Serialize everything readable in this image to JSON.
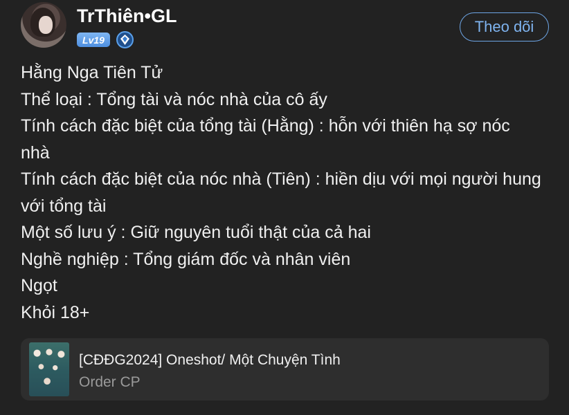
{
  "author": {
    "name": "TrThiên•GL",
    "level_badge": "Lv19",
    "verified_icon": "diamond-badge-icon"
  },
  "follow_button": {
    "label": "Theo dõi"
  },
  "post": {
    "lines": [
      "Hằng Nga Tiên Tử",
      "Thể loại : Tổng tài và nóc nhà của cô ấy",
      "Tính cách đặc biệt của tổng tài (Hằng) : hỗn với thiên hạ sợ nóc",
      "nhà",
      "Tính cách đặc biệt của nóc nhà (Tiên) : hiền dịu với mọi người hung",
      "với tổng tài",
      "Một số lưu ý : Giữ nguyên tuổi thật của cả hai",
      "Nghề nghiệp : Tổng giám đốc và nhân viên",
      "Ngọt",
      "Khỏi 18+"
    ]
  },
  "attachment": {
    "title": "[CĐĐG2024] Oneshot/ Một Chuyện Tình",
    "subtitle": "Order CP"
  },
  "colors": {
    "background": "#222222",
    "accent": "#7fb4f0",
    "card": "#2e2e2e",
    "muted_text": "#9a9a9a"
  }
}
